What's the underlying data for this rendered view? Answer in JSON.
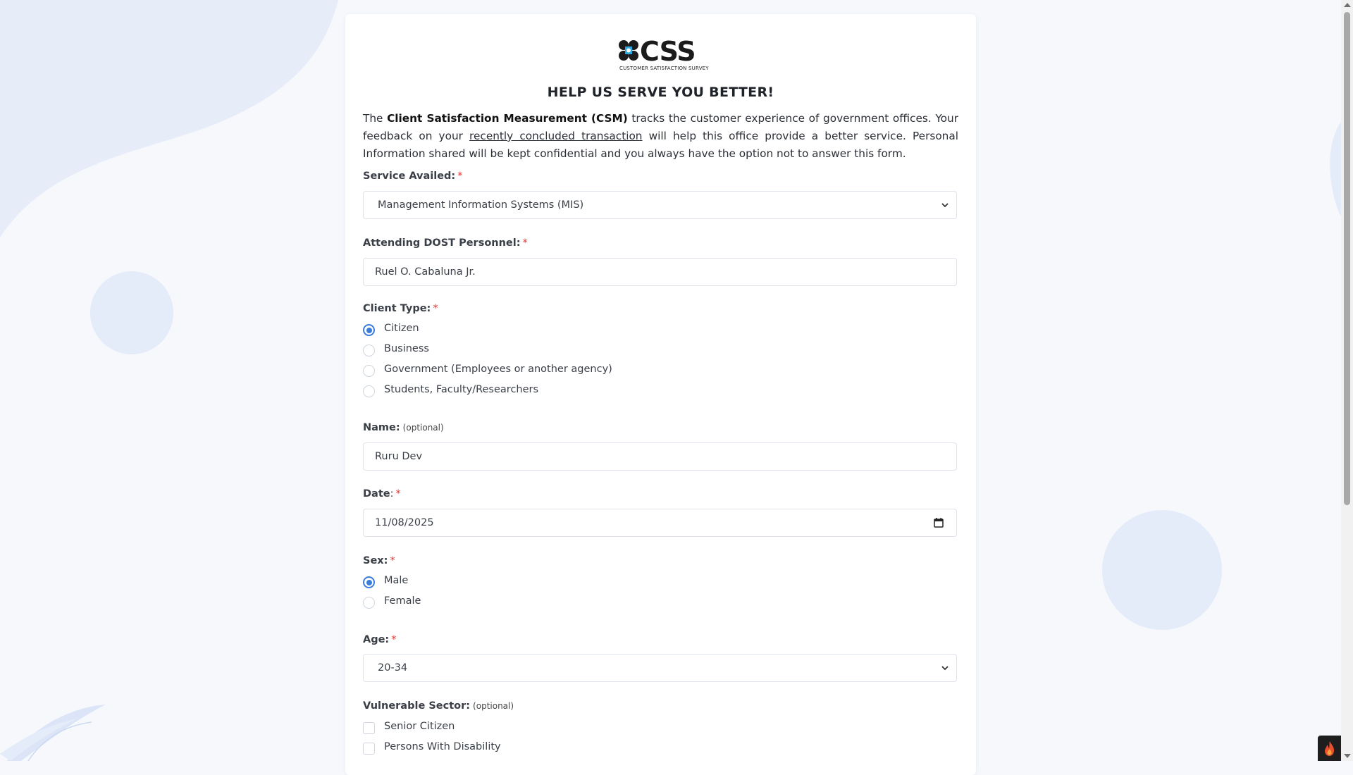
{
  "logo": {
    "text": "CSS",
    "subtitle": "CUSTOMER SATISFACTION SURVEY"
  },
  "title": "HELP US SERVE YOU BETTER!",
  "intro": {
    "p1": "The ",
    "bold": "Client Satisfaction Measurement (CSM)",
    "p2": " tracks the customer experience of government offices. Your feedback on your ",
    "underlined": "recently concluded transaction",
    "p3": " will help this office provide a better service. Personal Information shared will be kept confidential and you always have the option not to answer this form."
  },
  "service": {
    "label": "Service Availed:",
    "required": "*",
    "value": "Management Information Systems (MIS)"
  },
  "personnel": {
    "label": "Attending DOST Personnel:",
    "required": "*",
    "value": "Ruel O. Cabaluna Jr."
  },
  "client_type": {
    "label": "Client Type:",
    "required": "*",
    "options": [
      {
        "label": "Citizen",
        "selected": true
      },
      {
        "label": "Business",
        "selected": false
      },
      {
        "label": "Government (Employees or another agency)",
        "selected": false
      },
      {
        "label": "Students, Faculty/Researchers",
        "selected": false
      }
    ]
  },
  "name": {
    "label": "Name:",
    "optional": "(optional)",
    "value": "Ruru Dev"
  },
  "date": {
    "label": "Date",
    "colon": ":",
    "required": "*",
    "value": "11/08/2025"
  },
  "sex": {
    "label": "Sex:",
    "required": "*",
    "options": [
      {
        "label": "Male",
        "selected": true
      },
      {
        "label": "Female",
        "selected": false
      }
    ]
  },
  "age": {
    "label": "Age:",
    "required": "*",
    "value": "20-34"
  },
  "vulnerable": {
    "label": "Vulnerable Sector:",
    "optional": "(optional)",
    "options": [
      {
        "label": "Senior Citizen",
        "checked": false
      },
      {
        "label": "Persons With Disability",
        "checked": false
      }
    ]
  },
  "colors": {
    "accent": "#3b7ddd",
    "required": "#e3342f",
    "background": "#f6f8fc",
    "shape": "#e4ebf9"
  }
}
